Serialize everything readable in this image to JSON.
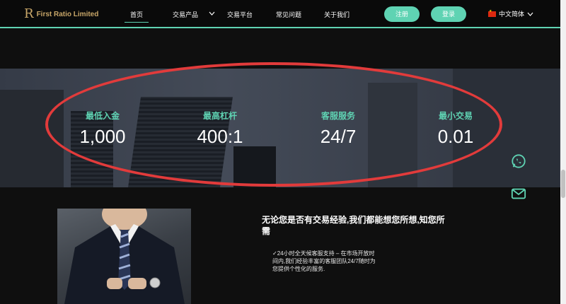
{
  "header": {
    "logo_mark": "R",
    "brand": "First Ratio Limited",
    "nav": [
      "首页",
      "交易产品",
      "交易平台",
      "常见问题",
      "关于我们"
    ],
    "register_label": "注册",
    "login_label": "登录",
    "language": "中文简体"
  },
  "stats": [
    {
      "label": "最低入金",
      "value": "1,000"
    },
    {
      "label": "最高杠杆",
      "value": "400:1"
    },
    {
      "label": "客服服务",
      "value": "24/7"
    },
    {
      "label": "最小交易",
      "value": "0.01"
    }
  ],
  "content": {
    "heading": "无论您是否有交易经验,我们都能想您所想,知您所需",
    "bullet": "✓24小时全天候客服支持 – 在市场开放时间内,我们经验丰富的客服团队24/7随时为您提供个性化的服务."
  },
  "colors": {
    "accent": "#5fd3b3",
    "brand_gold": "#c8a668",
    "annotation_red": "#e23b3b"
  }
}
